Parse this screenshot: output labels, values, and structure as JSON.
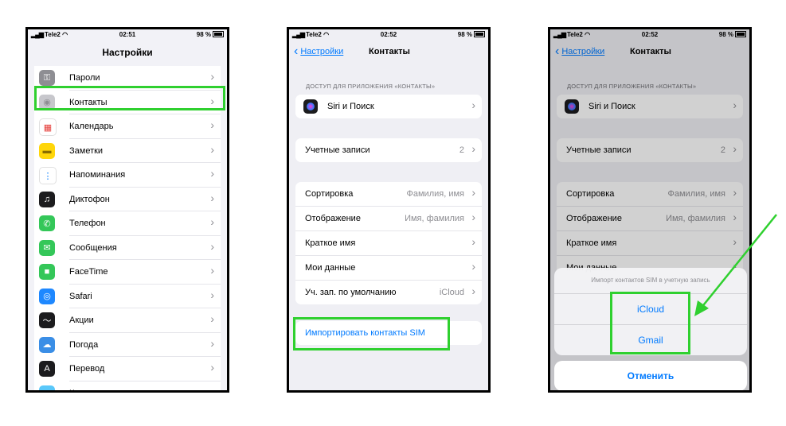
{
  "status": {
    "carrier": "Tele2",
    "battery": "98 %",
    "time1": "02:51",
    "time2": "02:52",
    "time3": "02:52"
  },
  "screen1": {
    "title": "Настройки",
    "items": [
      {
        "label": "Пароли",
        "icon": "key-icon",
        "color": "#8e8e93"
      },
      {
        "label": "Контакты",
        "icon": "contacts-icon",
        "color": "#c7c7cc"
      },
      {
        "label": "Календарь",
        "icon": "calendar-icon",
        "color": "#ffffff"
      },
      {
        "label": "Заметки",
        "icon": "notes-icon",
        "color": "#ffd60a"
      },
      {
        "label": "Напоминания",
        "icon": "reminders-icon",
        "color": "#ffffff"
      },
      {
        "label": "Диктофон",
        "icon": "voice-memo-icon",
        "color": "#1c1c1e"
      },
      {
        "label": "Телефон",
        "icon": "phone-icon",
        "color": "#34c759"
      },
      {
        "label": "Сообщения",
        "icon": "messages-icon",
        "color": "#34c759"
      },
      {
        "label": "FaceTime",
        "icon": "facetime-icon",
        "color": "#34c759"
      },
      {
        "label": "Safari",
        "icon": "safari-icon",
        "color": "#1e88ff"
      },
      {
        "label": "Акции",
        "icon": "stocks-icon",
        "color": "#1c1c1e"
      },
      {
        "label": "Погода",
        "icon": "weather-icon",
        "color": "#3a8ee6"
      },
      {
        "label": "Перевод",
        "icon": "translate-icon",
        "color": "#1c1c1e"
      },
      {
        "label": "Карты",
        "icon": "maps-icon",
        "color": "#5ac8fa"
      }
    ]
  },
  "screen2": {
    "back": "Настройки",
    "title": "Контакты",
    "section_header": "ДОСТУП ДЛЯ ПРИЛОЖЕНИЯ «КОНТАКТЫ»",
    "siri": "Siri и Поиск",
    "accounts": {
      "label": "Учетные записи",
      "value": "2"
    },
    "settings": [
      {
        "label": "Сортировка",
        "value": "Фамилия, имя"
      },
      {
        "label": "Отображение",
        "value": "Имя, фамилия"
      },
      {
        "label": "Краткое имя",
        "value": ""
      },
      {
        "label": "Мои данные",
        "value": ""
      },
      {
        "label": "Уч. зап. по умолчанию",
        "value": "iCloud"
      }
    ],
    "import": "Импортировать контакты SIM"
  },
  "screen3": {
    "sheet_title": "Импорт контактов SIM в учетную запись",
    "options": [
      "iCloud",
      "Gmail"
    ],
    "cancel": "Отменить"
  },
  "colors": {
    "highlight": "#2fd02f",
    "link": "#007aff"
  }
}
